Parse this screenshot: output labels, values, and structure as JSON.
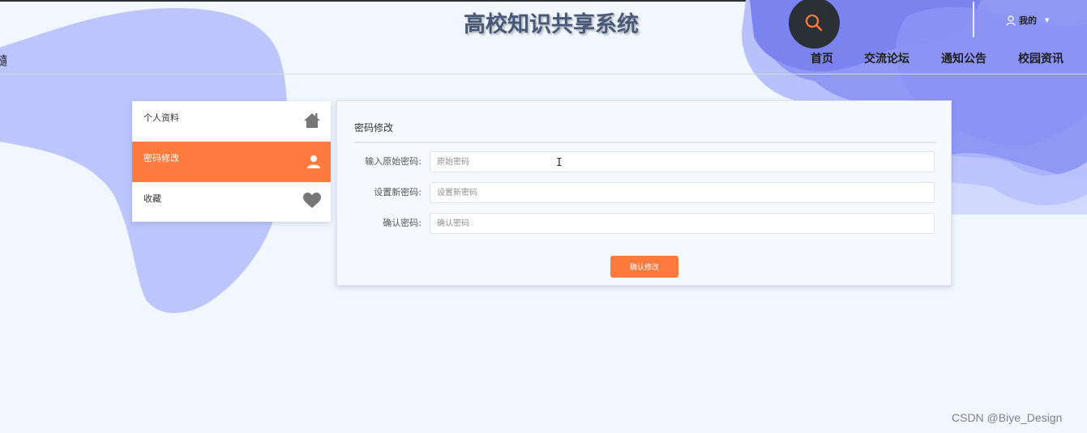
{
  "header": {
    "site_title": "高校知识共享系统",
    "left_partial_text": "髓",
    "user_menu_label": "我的"
  },
  "nav": {
    "items": [
      {
        "label": "首页"
      },
      {
        "label": "交流论坛"
      },
      {
        "label": "通知公告"
      },
      {
        "label": "校园资讯"
      }
    ]
  },
  "sidebar": {
    "items": [
      {
        "label": "个人资料",
        "icon": "home-icon",
        "active": false
      },
      {
        "label": "密码修改",
        "icon": "user-icon",
        "active": true
      },
      {
        "label": "收藏",
        "icon": "heart-icon",
        "active": false
      }
    ]
  },
  "form": {
    "title": "密码修改",
    "fields": [
      {
        "label": "输入原始密码:",
        "placeholder": "原始密码"
      },
      {
        "label": "设置新密码:",
        "placeholder": "设置新密码"
      },
      {
        "label": "确认密码:",
        "placeholder": "确认密码"
      }
    ],
    "submit_label": "确认修改"
  },
  "watermark": "CSDN @Biye_Design",
  "colors": {
    "accent": "#ff7b3d",
    "background": "#f0f7fe",
    "title_text": "#4a5878",
    "blob_light": "#bcc6fd",
    "blob_mid": "#8f98f5",
    "blob_dark": "#7b83ef",
    "search_button": "#2b2f36"
  }
}
